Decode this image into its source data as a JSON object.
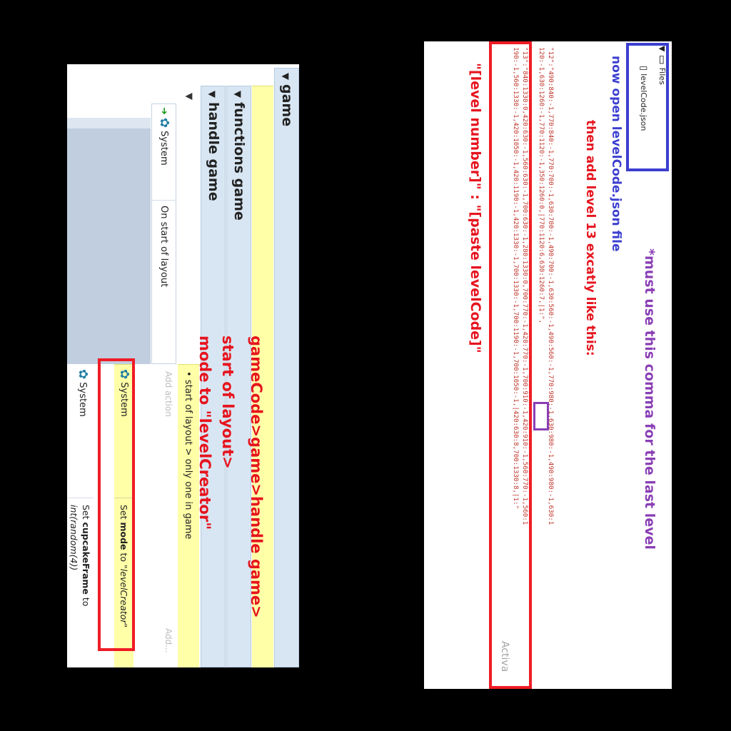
{
  "left": {
    "groups": {
      "game": "game",
      "functions_game": "functions game",
      "handle_game": "handle game"
    },
    "event": {
      "condition_object": "System",
      "condition_text": "On start of layout",
      "comment": "• start of layout > only one in game",
      "add_action_label": "Add action",
      "add_label": "Add..."
    },
    "actions": [
      {
        "object": "System",
        "pre": "Set ",
        "strong": "mode",
        "mid": " to ",
        "italic": "\"levelCreator\""
      },
      {
        "object": "System",
        "pre": "Set ",
        "strong": "cupcakeFrame",
        "mid": " to ",
        "italic": "int(random(4))"
      }
    ],
    "annotation": {
      "line1": "gameCode>game>handle game>",
      "line2": "start of layout>",
      "line3": "mode to \"levelCreator\""
    }
  },
  "right": {
    "file_tree": {
      "root": "Files",
      "file": "levelCode.json"
    },
    "annotations": {
      "must_use": "*must use this comma for the last level",
      "now_open": "now open levelCode.json file",
      "then_add": "then add level 13 excatly like this:",
      "format": "\"[level number]\" : \"[paste levelCode]\""
    },
    "code_lines": [
      "\"12\":\"490:840:-1,770:840:-1,770:700:-1,630:700:-1,490:700:-1,630:560:-1,490:560:-1,770:980:-1,630:980:-1,490:980:-1,630:1",
      "120:-1,630:1260:-1,770:1120:-1,350:1260:0,|770:1120:6,630:1260:7,|1:\",",
      "\"13\":\"840:1330:0,420:630:-1,560:630:-1,700:630:-1,280:1330:0,700:770:-1,420:770:-1,700:910:-1,420:910:-1,560:770:-1,560:1",
      "190:-1,560:1330:-1,420:1050:-1,420:1190:-1,420:1330:-1,700:1330:-1,700:1190:-1,700:1050:-1,|420:630:8,700:1330:8,|1:\""
    ],
    "watermark": "Activa"
  }
}
